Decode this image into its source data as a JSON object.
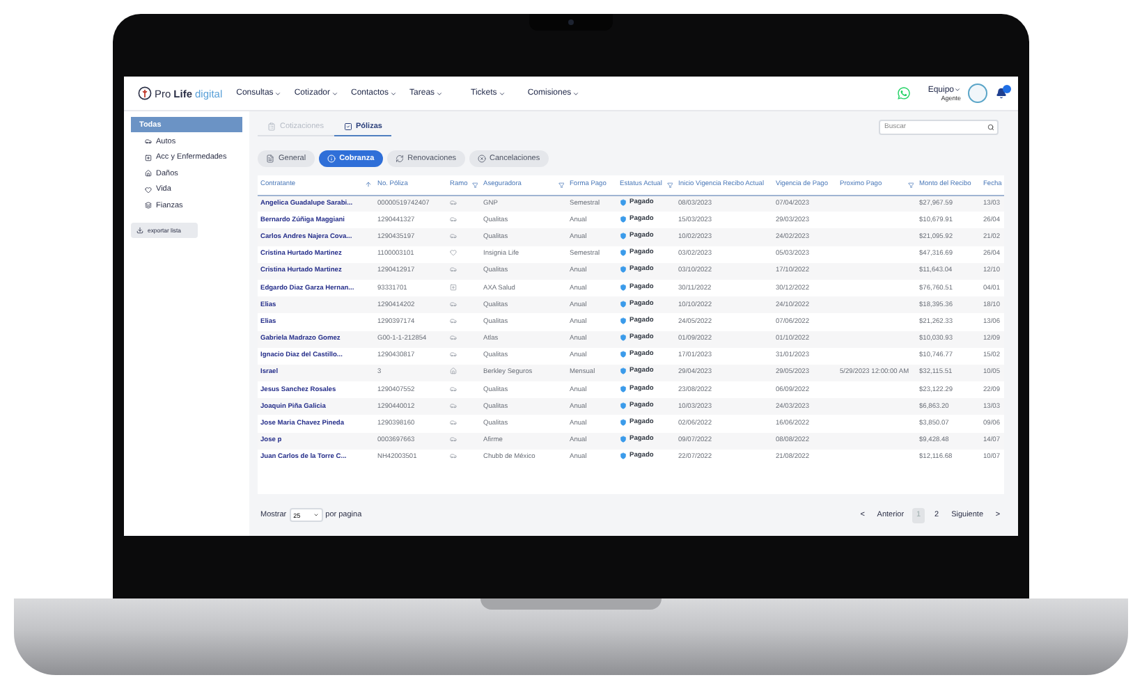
{
  "header": {
    "logo": {
      "brand_a": "Pro",
      "brand_b": "Life",
      "brand_c": "digital"
    },
    "menu": [
      {
        "label": "Consultas"
      },
      {
        "label": "Cotizador"
      },
      {
        "label": "Contactos"
      },
      {
        "label": "Tareas"
      },
      {
        "label": "Tickets"
      },
      {
        "label": "Comisiones"
      }
    ],
    "user": {
      "team": "Equipo",
      "role": "Agente"
    }
  },
  "sidebar": {
    "items": [
      {
        "label": "Todas",
        "kind": "all",
        "selected": true
      },
      {
        "label": "Autos",
        "kind": "auto",
        "selected": false
      },
      {
        "label": "Acc y Enfermedades",
        "kind": "salud",
        "selected": false
      },
      {
        "label": "Daños",
        "kind": "danos",
        "selected": false
      },
      {
        "label": "Vida",
        "kind": "vida",
        "selected": false
      },
      {
        "label": "Fianzas",
        "kind": "fianzas",
        "selected": false
      }
    ],
    "export_button": "exportar lista"
  },
  "tabs": [
    {
      "label": "Cotizaciones",
      "selected": false
    },
    {
      "label": "Pólizas",
      "selected": true
    }
  ],
  "search": {
    "placeholder": "Buscar"
  },
  "subtabs": [
    {
      "label": "General",
      "kind": "general",
      "selected": false
    },
    {
      "label": "Cobranza",
      "kind": "cobranza",
      "selected": true
    },
    {
      "label": "Renovaciones",
      "kind": "renovaciones",
      "selected": false
    },
    {
      "label": "Cancelaciones",
      "kind": "cancelaciones",
      "selected": false
    }
  ],
  "table": {
    "columns": [
      {
        "label": "Contratante",
        "kind": "sort"
      },
      {
        "label": "No. Póliza",
        "kind": "plain"
      },
      {
        "label": "Ramo",
        "kind": "filter"
      },
      {
        "label": "Aseguradora",
        "kind": "filter"
      },
      {
        "label": "Forma Pago",
        "kind": "plain"
      },
      {
        "label": "Estatus Actual",
        "kind": "filter"
      },
      {
        "label": "Inicio Vigencia Recibo Actual",
        "kind": "plain"
      },
      {
        "label": "Vigencia de Pago",
        "kind": "plain"
      },
      {
        "label": "Proximo Pago",
        "kind": "filter"
      },
      {
        "label": "Monto del Recibo",
        "kind": "plain"
      },
      {
        "label": "Fecha",
        "kind": "plain"
      }
    ],
    "rows": [
      {
        "contratante": "Angelica Guadalupe Sarabi...",
        "poliza": "00000519742407",
        "kind": "auto",
        "aseguradora": "GNP",
        "forma_pago": "Semestral",
        "estatus": "Pagado",
        "inicio": "08/03/2023",
        "vigencia": "07/04/2023",
        "monto": "$27,967.59",
        "fecha": "13/03"
      },
      {
        "contratante": "Bernardo Zúñiga Maggiani",
        "poliza": "1290441327",
        "kind": "auto",
        "aseguradora": "Qualitas",
        "forma_pago": "Anual",
        "estatus": "Pagado",
        "inicio": "15/03/2023",
        "vigencia": "29/03/2023",
        "monto": "$10,679.91",
        "fecha": "26/04"
      },
      {
        "contratante": "Carlos Andres Najera Cova...",
        "poliza": "1290435197",
        "kind": "auto",
        "aseguradora": "Qualitas",
        "forma_pago": "Anual",
        "estatus": "Pagado",
        "inicio": "10/02/2023",
        "vigencia": "24/02/2023",
        "monto": "$21,095.92",
        "fecha": "21/02"
      },
      {
        "contratante": "Cristina Hurtado Martinez",
        "poliza": "1100003101",
        "kind": "vida",
        "aseguradora": "Insignia Life",
        "forma_pago": "Semestral",
        "estatus": "Pagado",
        "inicio": "03/02/2023",
        "vigencia": "05/03/2023",
        "monto": "$47,316.69",
        "fecha": "26/04"
      },
      {
        "contratante": "Cristina Hurtado Martinez",
        "poliza": "1290412917",
        "kind": "auto",
        "aseguradora": "Qualitas",
        "forma_pago": "Anual",
        "estatus": "Pagado",
        "inicio": "03/10/2022",
        "vigencia": "17/10/2022",
        "monto": "$11,643.04",
        "fecha": "12/10"
      },
      {
        "contratante": "Edgardo Diaz Garza Hernan...",
        "poliza": "93331701",
        "kind": "salud",
        "aseguradora": "AXA Salud",
        "forma_pago": "Anual",
        "estatus": "Pagado",
        "inicio": "30/11/2022",
        "vigencia": "30/12/2022",
        "monto": "$76,760.51",
        "fecha": "04/01"
      },
      {
        "contratante": "Elias",
        "poliza": "1290414202",
        "kind": "auto",
        "aseguradora": "Qualitas",
        "forma_pago": "Anual",
        "estatus": "Pagado",
        "inicio": "10/10/2022",
        "vigencia": "24/10/2022",
        "monto": "$18,395.36",
        "fecha": "18/10"
      },
      {
        "contratante": "Elias",
        "poliza": "1290397174",
        "kind": "auto",
        "aseguradora": "Qualitas",
        "forma_pago": "Anual",
        "estatus": "Pagado",
        "inicio": "24/05/2022",
        "vigencia": "07/06/2022",
        "monto": "$21,262.33",
        "fecha": "13/06"
      },
      {
        "contratante": "Gabriela Madrazo Gomez",
        "poliza": "G00-1-1-212854",
        "kind": "auto",
        "aseguradora": "Atlas",
        "forma_pago": "Anual",
        "estatus": "Pagado",
        "inicio": "01/09/2022",
        "vigencia": "01/10/2022",
        "monto": "$10,030.93",
        "fecha": "12/09"
      },
      {
        "contratante": "Ignacio Diaz del Castillo...",
        "poliza": "1290430817",
        "kind": "auto",
        "aseguradora": "Qualitas",
        "forma_pago": "Anual",
        "estatus": "Pagado",
        "inicio": "17/01/2023",
        "vigencia": "31/01/2023",
        "monto": "$10,746.77",
        "fecha": "15/02"
      },
      {
        "contratante": "Israel",
        "poliza": "3",
        "kind": "danos",
        "aseguradora": "Berkley Seguros",
        "forma_pago": "Mensual",
        "estatus": "Pagado",
        "inicio": "29/04/2023",
        "vigencia": "29/05/2023",
        "proximo": "5/29/2023 12:00:00 AM",
        "monto": "$32,115.51",
        "fecha": "10/05"
      },
      {
        "contratante": "Jesus Sanchez Rosales",
        "poliza": "1290407552",
        "kind": "auto",
        "aseguradora": "Qualitas",
        "forma_pago": "Anual",
        "estatus": "Pagado",
        "inicio": "23/08/2022",
        "vigencia": "06/09/2022",
        "monto": "$23,122.29",
        "fecha": "22/09"
      },
      {
        "contratante": "Joaquin Piña Galicia",
        "poliza": "1290440012",
        "kind": "auto",
        "aseguradora": "Qualitas",
        "forma_pago": "Anual",
        "estatus": "Pagado",
        "inicio": "10/03/2023",
        "vigencia": "24/03/2023",
        "monto": "$6,863.20",
        "fecha": "13/03"
      },
      {
        "contratante": "Jose Maria Chavez Pineda",
        "poliza": "1290398160",
        "kind": "auto",
        "aseguradora": "Qualitas",
        "forma_pago": "Anual",
        "estatus": "Pagado",
        "inicio": "02/06/2022",
        "vigencia": "16/06/2022",
        "monto": "$3,850.07",
        "fecha": "09/06"
      },
      {
        "contratante": "Jose p",
        "poliza": "0003697663",
        "kind": "auto",
        "aseguradora": "Afirme",
        "forma_pago": "Anual",
        "estatus": "Pagado",
        "inicio": "09/07/2022",
        "vigencia": "08/08/2022",
        "monto": "$9,428.48",
        "fecha": "14/07"
      },
      {
        "contratante": "Juan Carlos de la Torre C...",
        "poliza": "NH42003501",
        "kind": "auto",
        "aseguradora": "Chubb de México",
        "forma_pago": "Anual",
        "estatus": "Pagado",
        "inicio": "22/07/2022",
        "vigencia": "21/08/2022",
        "monto": "$12,116.68",
        "fecha": "10/07"
      }
    ]
  },
  "footer": {
    "show_label": "Mostrar",
    "page_size": "25",
    "per_page_label": "por pagina",
    "prev_arrow": "<",
    "prev": "Anterior",
    "pages": [
      {
        "label": "1",
        "selected": true
      },
      {
        "label": "2",
        "selected": false
      }
    ],
    "next": "Siguiente",
    "next_arrow": ">"
  }
}
